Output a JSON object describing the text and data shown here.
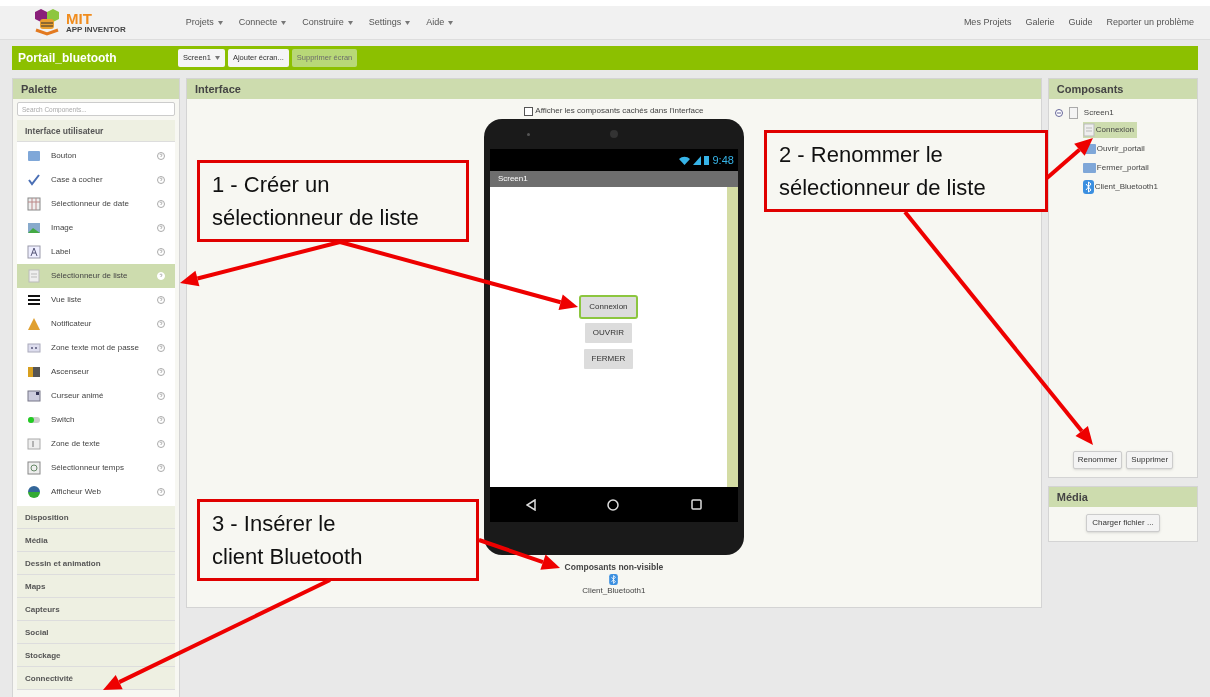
{
  "header": {
    "logo": {
      "title": "MIT",
      "subtitle": "APP INVENTOR"
    },
    "menus": [
      "Projets",
      "Connecte",
      "Construire",
      "Settings",
      "Aide"
    ],
    "links": [
      "Mes Projets",
      "Galerie",
      "Guide",
      "Reporter un problème"
    ]
  },
  "project_bar": {
    "title": "Portail_bluetooth",
    "buttons": [
      {
        "label": "Screen1",
        "kind": "dropdown",
        "disabled": false
      },
      {
        "label": "Ajouter écran...",
        "kind": "plain",
        "disabled": false
      },
      {
        "label": "Supprimer écran",
        "kind": "plain",
        "disabled": true
      }
    ]
  },
  "palette": {
    "title": "Palette",
    "search": {
      "placeholder": "Search Components..."
    },
    "open_category": "Interface utilisateur",
    "items": [
      {
        "label": "Bouton",
        "selected": false
      },
      {
        "label": "Case à cocher",
        "selected": false
      },
      {
        "label": "Sélectionneur de date",
        "selected": false
      },
      {
        "label": "Image",
        "selected": false
      },
      {
        "label": "Label",
        "selected": false
      },
      {
        "label": "Sélectionneur de liste",
        "selected": true
      },
      {
        "label": "Vue liste",
        "selected": false
      },
      {
        "label": "Notificateur",
        "selected": false
      },
      {
        "label": "Zone texte mot de passe",
        "selected": false
      },
      {
        "label": "Ascenseur",
        "selected": false
      },
      {
        "label": "Curseur animé",
        "selected": false
      },
      {
        "label": "Switch",
        "selected": false
      },
      {
        "label": "Zone de texte",
        "selected": false
      },
      {
        "label": "Sélectionneur temps",
        "selected": false
      },
      {
        "label": "Afficheur Web",
        "selected": false
      }
    ],
    "categories": [
      "Disposition",
      "Média",
      "Dessin et animation",
      "Maps",
      "Capteurs",
      "Social",
      "Stockage",
      "Connectivité"
    ]
  },
  "viewer": {
    "title": "Interface",
    "checkbox": {
      "label": "Afficher les composants cachés dans l'interface",
      "checked": false
    },
    "phone": {
      "time": "9:48",
      "screen_title": "Screen1",
      "buttons": [
        {
          "label": "Connexion",
          "selected": true
        },
        {
          "label": "OUVRIR",
          "selected": false
        },
        {
          "label": "FERMER",
          "selected": false
        }
      ]
    },
    "non_visible": {
      "title": "Composants non-visible",
      "items": [
        "Client_Bluetooth1"
      ]
    }
  },
  "components": {
    "title": "Composants",
    "tree": {
      "label": "Screen1",
      "expanded": true,
      "children": [
        {
          "label": "Connexion",
          "selected": true
        },
        {
          "label": "Ouvrir_portail",
          "selected": false
        },
        {
          "label": "Fermer_portail",
          "selected": false
        },
        {
          "label": "Client_Bluetooth1",
          "selected": false
        }
      ]
    },
    "buttons": [
      "Renommer",
      "Supprimer"
    ]
  },
  "media": {
    "title": "Média",
    "button": "Charger fichier ..."
  },
  "annotations": [
    {
      "lines": [
        "1 - Créer un",
        "sélectionneur de liste"
      ]
    },
    {
      "lines": [
        "2 - Renommer le",
        "sélectionneur de liste"
      ]
    },
    {
      "lines": [
        "3 - Insérer le",
        "client Bluetooth"
      ]
    }
  ]
}
